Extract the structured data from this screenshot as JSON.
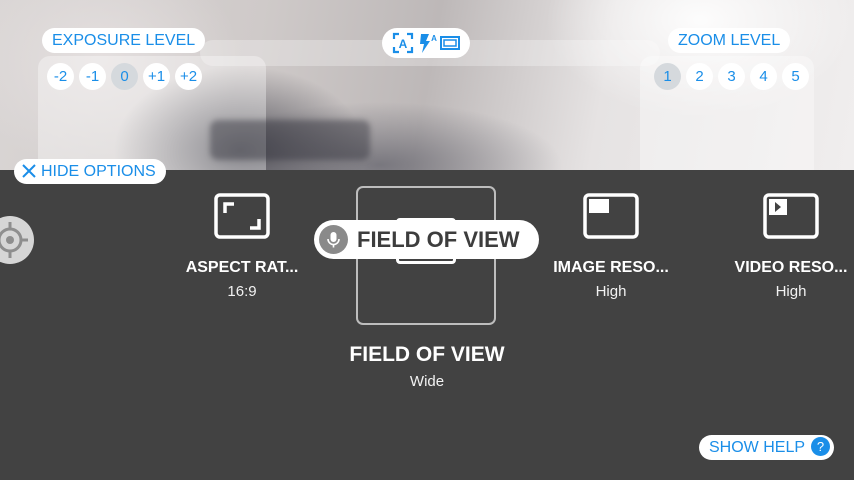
{
  "exposure": {
    "label": "EXPOSURE LEVEL",
    "levels": [
      "-2",
      "-1",
      "0",
      "+1",
      "+2"
    ],
    "selected": "0"
  },
  "zoom": {
    "label": "ZOOM LEVEL",
    "levels": [
      "1",
      "2",
      "3",
      "4",
      "5"
    ],
    "selected": "1"
  },
  "mode_pill": {
    "icons": [
      "auto-focus-icon",
      "flash-auto-icon",
      "screen-ratio-icon"
    ]
  },
  "hide_options": {
    "label": "HIDE OPTIONS",
    "icon": "close-icon"
  },
  "options": [
    {
      "title": "ASPECT RAT...",
      "value": "16:9",
      "icon": "aspect-ratio-icon"
    },
    {
      "title": "FIELD OF VIEW",
      "value": "Wide",
      "icon": "field-of-view-icon"
    },
    {
      "title": "IMAGE RESO...",
      "value": "High",
      "icon": "image-resolution-icon"
    },
    {
      "title": "VIDEO RESO...",
      "value": "High",
      "icon": "video-resolution-icon"
    }
  ],
  "voice_pill": {
    "label": "FIELD OF VIEW",
    "icon": "mic-icon"
  },
  "show_help": {
    "label": "SHOW HELP",
    "icon_text": "?"
  },
  "colors": {
    "accent": "#1a8ee8",
    "panel": "#424242",
    "selected_chip": "#d5d9dd"
  }
}
